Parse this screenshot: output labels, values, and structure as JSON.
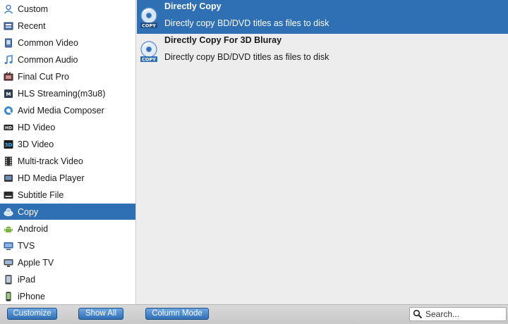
{
  "sidebar": {
    "items": [
      {
        "label": "Custom",
        "icon": "person-icon"
      },
      {
        "label": "Recent",
        "icon": "recent-icon"
      },
      {
        "label": "Common Video",
        "icon": "video-file-icon"
      },
      {
        "label": "Common Audio",
        "icon": "music-note-icon"
      },
      {
        "label": "Final Cut Pro",
        "icon": "final-cut-icon"
      },
      {
        "label": "HLS Streaming(m3u8)",
        "icon": "hls-streaming-icon"
      },
      {
        "label": "Avid Media Composer",
        "icon": "avid-icon"
      },
      {
        "label": "HD Video",
        "icon": "hd-icon"
      },
      {
        "label": "3D Video",
        "icon": "3d-icon"
      },
      {
        "label": "Multi-track Video",
        "icon": "film-strip-icon"
      },
      {
        "label": "HD Media Player",
        "icon": "media-player-icon"
      },
      {
        "label": "Subtitle File",
        "icon": "subtitle-icon"
      },
      {
        "label": "Copy",
        "icon": "copy-disc-icon",
        "selected": true
      },
      {
        "label": "Android",
        "icon": "android-icon"
      },
      {
        "label": "TVS",
        "icon": "tv-icon"
      },
      {
        "label": "Apple TV",
        "icon": "apple-tv-icon"
      },
      {
        "label": "iPad",
        "icon": "ipad-icon"
      },
      {
        "label": "iPhone",
        "icon": "iphone-icon"
      }
    ]
  },
  "formats": [
    {
      "title": "Directly Copy",
      "description": "Directly copy BD/DVD titles as files to disk",
      "icon": "disc-copy-icon",
      "badge": "COPY",
      "selected": true
    },
    {
      "title": "Directly Copy For 3D Bluray",
      "description": "Directly copy BD/DVD titles as files to disk",
      "icon": "disc-copy-3d-icon",
      "badge": "COPY",
      "selected": false
    }
  ],
  "toolbar": {
    "customize_label": "Customize",
    "show_all_label": "Show All",
    "column_mode_label": "Column Mode"
  },
  "search": {
    "placeholder": "Search...",
    "icon": "search-icon"
  },
  "colors": {
    "accent": "#2f6fb3",
    "android_green": "#7cb342"
  }
}
